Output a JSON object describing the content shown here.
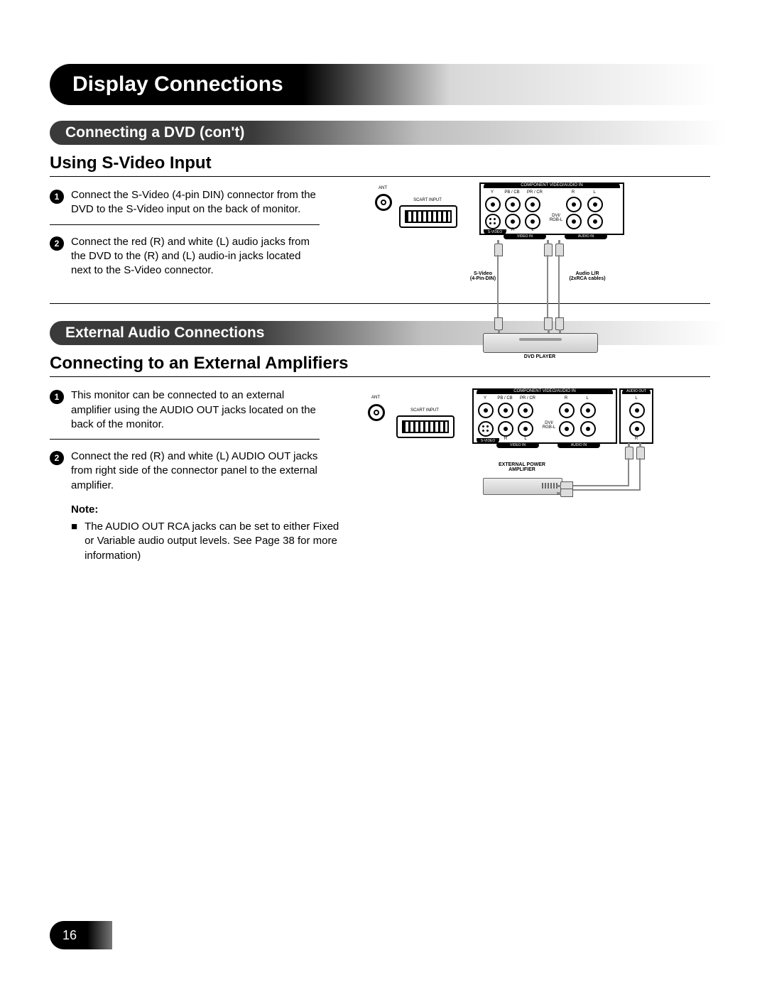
{
  "page_title": "Display Connections",
  "page_number": "16",
  "section1": {
    "bar": "Connecting a DVD (con't)",
    "heading": "Using S-Video Input",
    "steps": [
      {
        "num": "1",
        "text": "Connect the S-Video (4-pin DIN) connector from the DVD to the S-Video input on the back of monitor."
      },
      {
        "num": "2",
        "text": "Connect the red (R) and white (L) audio jacks from the DVD to the (R) and (L) audio-in jacks located next to the S-Video connector."
      }
    ],
    "diagram": {
      "ant": "ANT",
      "scart": "SCART INPUT",
      "panel_top": "COMPONENT VIDEO/AUDIO IN",
      "y": "Y",
      "pb": "PB / CB",
      "pr": "PR / CR",
      "r": "R",
      "l": "L",
      "svideo": "S-VIDEO",
      "videoin": "VIDEO IN",
      "dvirgb": "DVI/\nRGB-L",
      "audioin": "AUDIO IN",
      "cable1": "S-Video\n(4-Pin-DIN)",
      "cable2": "Audio L/R\n(2xRCA cables)",
      "device": "DVD PLAYER"
    }
  },
  "section2": {
    "bar": "External Audio Connections",
    "heading": "Connecting to an External Amplifiers",
    "steps": [
      {
        "num": "1",
        "text": "This monitor can be connected to an external amplifier using the AUDIO OUT jacks located on the back of the monitor."
      },
      {
        "num": "2",
        "text": "Connect the red (R) and white (L) AUDIO OUT jacks from right side of the connector panel to the external amplifier."
      }
    ],
    "note_label": "Note:",
    "notes": [
      "The AUDIO OUT RCA jacks can be set to either Fixed or Variable audio output levels. See Page 38 for more information)"
    ],
    "diagram": {
      "ant": "ANT",
      "scart": "SCART INPUT",
      "panel_top": "COMPONENT VIDEO/AUDIO IN",
      "audio_out": "AUDIO OUT",
      "y": "Y",
      "pb": "PB / CB",
      "pr": "PR / CR",
      "r": "R",
      "l": "L",
      "svideo": "S-VIDEO",
      "videoin": "VIDEO IN",
      "dvirgb": "DVI/\nRGB-L",
      "audioin": "AUDIO IN",
      "device": "EXTERNAL POWER\nAMPLIFIER"
    }
  }
}
